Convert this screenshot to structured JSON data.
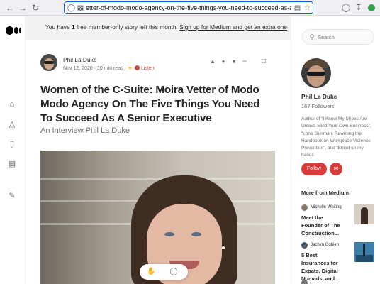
{
  "browser": {
    "url": "etter-of-modo-modo-agency-on-the-five-things-you-need-to-succeed-as-a-e9eea8390b32",
    "icons": [
      "back-icon",
      "forward-icon",
      "reload-icon",
      "shield-icon",
      "page-icon",
      "reader-view-icon",
      "bookmark-star-icon",
      "pocket-icon",
      "download-icon",
      "extension-icon"
    ]
  },
  "banner": {
    "prefix": "You have ",
    "count": "1",
    "middle": " free member-only story left this month. ",
    "link": "Sign up for Medium and get an extra one"
  },
  "article": {
    "author": "Phil La Duke",
    "date": "Nov 12, 2020",
    "read_time": "10 min read",
    "listen_label": "Listen",
    "title": "Women of the C-Suite: Moira Vetter of Modo Modo Agency On The Five Things You Need To Succeed As A Senior Executive",
    "subtitle": "An Interview Phil La Duke"
  },
  "sidebar": {
    "search_placeholder": "Search",
    "author_name": "Phil La Duke",
    "followers": "167 Followers",
    "bio": "Author of “I Know My Shoes Are Untied. Mind Your Own Business”, “Lone Gunman. Rewriting the Handbook on Workplace Violence Prevention”, and “Blood on my hands",
    "follow_label": "Follow",
    "more_heading": "More from Medium",
    "recommendations": [
      {
        "author": "Michelle Whiting",
        "title": "Meet the Founder of The Construction..."
      },
      {
        "author": "Jachim Gobien",
        "title": "5 Best Insurances for Expats, Digital Nomads, and..."
      }
    ]
  },
  "colors": {
    "accent": "#d93a3a",
    "text": "#242424",
    "muted": "#6b6b6b",
    "url_focus": "#0060df"
  }
}
